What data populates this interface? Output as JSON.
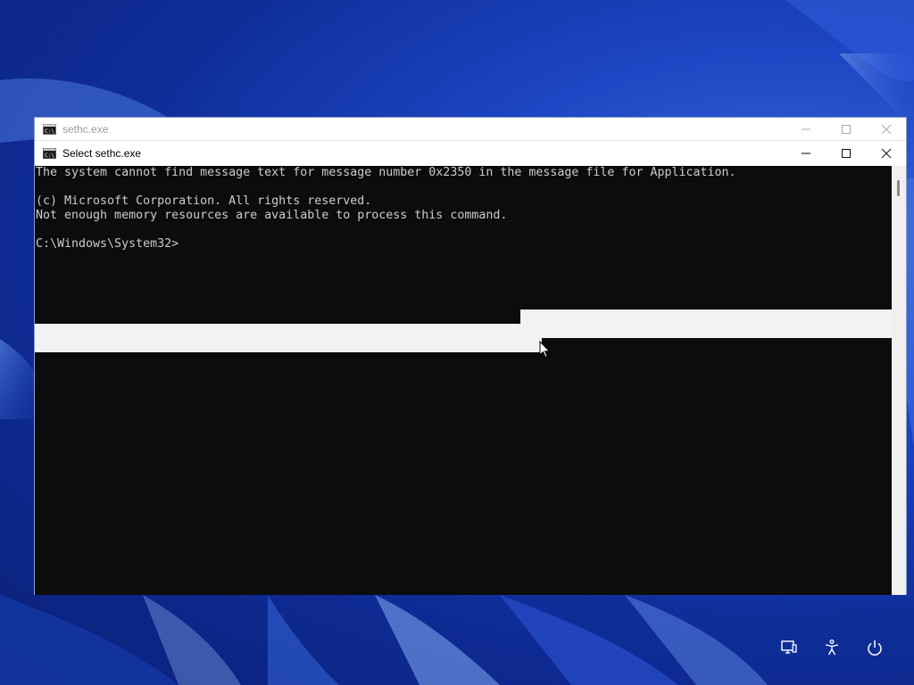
{
  "back_window": {
    "title": "sethc.exe",
    "icon": "console-icon",
    "buttons": [
      "minimize-icon",
      "maximize-icon",
      "close-icon"
    ]
  },
  "front_window": {
    "title": "Select sethc.exe",
    "icon": "console-icon",
    "buttons": [
      "minimize-icon",
      "maximize-icon",
      "close-icon"
    ]
  },
  "console": {
    "lines": [
      "The system cannot find message text for message number 0x2350 in the message file for Application.",
      "",
      "(c) Microsoft Corporation. All rights reserved.",
      "Not enough memory resources are available to process this command.",
      "",
      "C:\\Windows\\System32>"
    ],
    "background": "#0c0c0c",
    "foreground": "#cccccc",
    "selection_color": "#f2f2f2"
  },
  "lock_screen_tray": {
    "icons": [
      "network-icon",
      "accessibility-icon",
      "power-icon"
    ]
  },
  "colors": {
    "wallpaper": "#1d46c4",
    "window_frame": "#ffffff"
  }
}
